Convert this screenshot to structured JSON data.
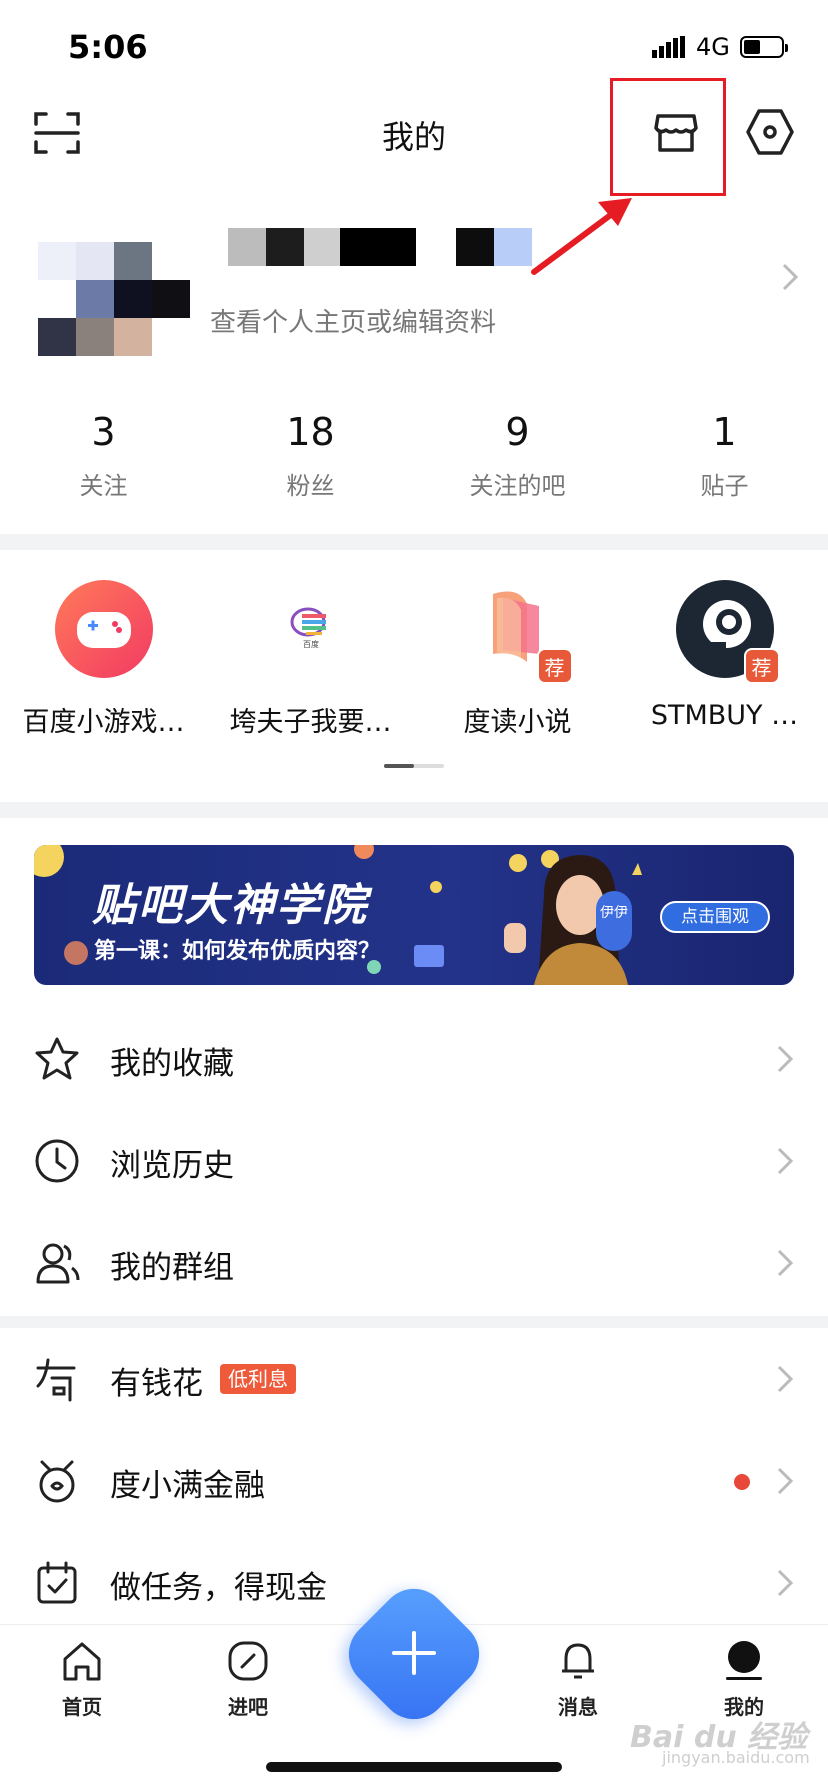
{
  "status_bar": {
    "time": "5:06",
    "network": "4G"
  },
  "header": {
    "title": "我的"
  },
  "profile": {
    "subtitle": "查看个人主页或编辑资料"
  },
  "stats": [
    {
      "value": "3",
      "label": "关注"
    },
    {
      "value": "18",
      "label": "粉丝"
    },
    {
      "value": "9",
      "label": "关注的吧"
    },
    {
      "value": "1",
      "label": "贴子"
    }
  ],
  "apps": [
    {
      "label": "百度小游戏…"
    },
    {
      "label": "垮夫子我要…",
      "icon_caption": "百度"
    },
    {
      "label": "度读小说",
      "badge": "荐"
    },
    {
      "label": "STMBUY …",
      "badge": "荐"
    }
  ],
  "banner": {
    "title": "贴吧大神学院",
    "subtitle": "第一课：如何发布优质内容？",
    "button": "点击围观",
    "tag": "伊伊"
  },
  "menu1": [
    {
      "label": "我的收藏",
      "icon": "star-icon"
    },
    {
      "label": "浏览历史",
      "icon": "clock-icon"
    },
    {
      "label": "我的群组",
      "icon": "group-icon"
    }
  ],
  "menu2": [
    {
      "label": "有钱花",
      "tag": "低利息",
      "icon": "youqianhua-icon"
    },
    {
      "label": "度小满金融",
      "icon": "duxiaoman-icon"
    },
    {
      "label": "做任务，得现金",
      "icon": "task-icon"
    }
  ],
  "tabbar": [
    {
      "label": "首页"
    },
    {
      "label": "进吧"
    },
    {
      "label": "消息"
    },
    {
      "label": "我的"
    }
  ],
  "watermark": {
    "text": "Bai du 经验",
    "sub": "jingyan.baidu.com"
  },
  "colors": {
    "accent": "#3470f2",
    "annotation": "#e51c23",
    "badge": "#ee5a3a"
  }
}
